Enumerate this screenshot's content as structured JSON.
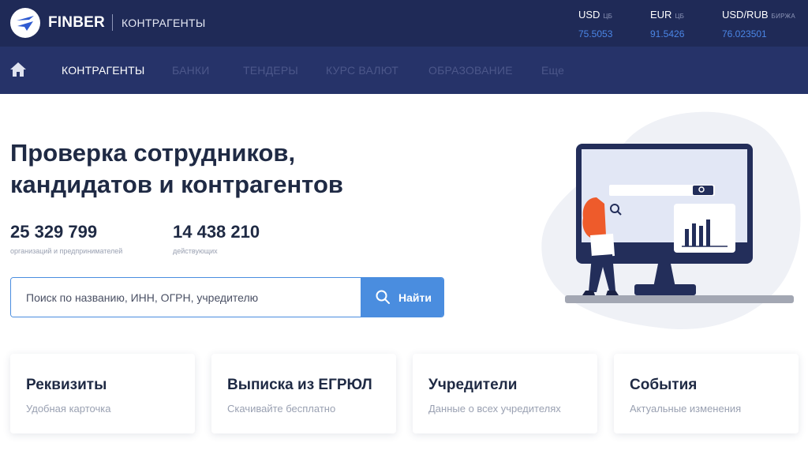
{
  "header": {
    "brand": "FINBER",
    "section": "КОНТРАГЕНТЫ",
    "rates": [
      {
        "code": "USD",
        "source": "ЦБ",
        "value": "75.5053"
      },
      {
        "code": "EUR",
        "source": "ЦБ",
        "value": "91.5426"
      },
      {
        "code": "USD/RUB",
        "source": "БИРЖА",
        "value": "76.023501"
      }
    ]
  },
  "nav": {
    "home_icon": "home-icon",
    "items": [
      {
        "label": "КОНТРАГЕНТЫ",
        "active": true
      },
      {
        "label": "БАНКИ",
        "active": false
      },
      {
        "label": "ТЕНДЕРЫ",
        "active": false
      },
      {
        "label": "КУРС ВАЛЮТ",
        "active": false
      },
      {
        "label": "ОБРАЗОВАНИЕ",
        "active": false
      },
      {
        "label": "Еще",
        "active": false
      }
    ]
  },
  "hero": {
    "title_line1": "Проверка сотрудников,",
    "title_line2": "кандидатов и контрагентов",
    "stats": [
      {
        "value": "25 329 799",
        "label": "организаций и предпринимателей"
      },
      {
        "value": "14 438 210",
        "label": "действующих"
      }
    ]
  },
  "search": {
    "placeholder": "Поиск по названию, ИНН, ОГРН, учредителю",
    "button_label": "Найти",
    "icon": "search-icon"
  },
  "cards": [
    {
      "title": "Реквизиты",
      "subtitle": "Удобная карточка"
    },
    {
      "title": "Выписка из ЕГРЮЛ",
      "subtitle": "Скачивайте бесплатно"
    },
    {
      "title": "Учредители",
      "subtitle": "Данные о всех учредителях"
    },
    {
      "title": "События",
      "subtitle": "Актуальные изменения"
    }
  ],
  "colors": {
    "topbar": "#1f2a57",
    "navbar": "#263369",
    "accent": "#4a8ddf",
    "heading": "#1f2a44",
    "muted": "#9aa1b2"
  }
}
